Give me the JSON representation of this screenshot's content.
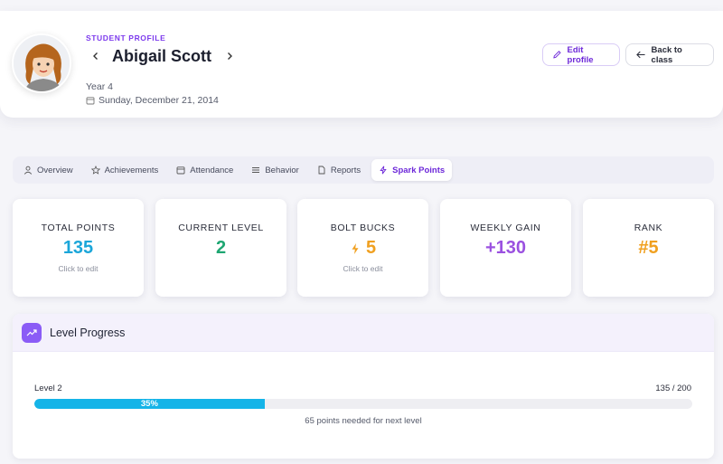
{
  "profile": {
    "eyebrow": "STUDENT PROFILE",
    "name": "Abigail Scott",
    "year": "Year 4",
    "birth_date": "Sunday, December 21, 2014",
    "edit_label": "Edit profile",
    "back_label": "Back to class"
  },
  "tabs": [
    {
      "label": "Overview",
      "icon": "user-icon"
    },
    {
      "label": "Achievements",
      "icon": "star-icon"
    },
    {
      "label": "Attendance",
      "icon": "calendar-icon"
    },
    {
      "label": "Behavior",
      "icon": "list-icon"
    },
    {
      "label": "Reports",
      "icon": "file-edit-icon"
    },
    {
      "label": "Spark Points",
      "icon": "bolt-icon",
      "active": true
    }
  ],
  "stats": [
    {
      "label": "TOTAL POINTS",
      "value": "135",
      "hint": "Click to edit",
      "color": "#1ba6d9"
    },
    {
      "label": "CURRENT LEVEL",
      "value": "2",
      "hint": "",
      "color": "#1ea672"
    },
    {
      "label": "BOLT BUCKS",
      "value": "5",
      "hint": "Click to edit",
      "color": "#f0a020",
      "icon": "bolt-icon"
    },
    {
      "label": "WEEKLY GAIN",
      "value": "+130",
      "hint": "",
      "color": "#9b51e0"
    },
    {
      "label": "RANK",
      "value": "#5",
      "hint": "",
      "color": "#f0a020"
    }
  ],
  "level_progress": {
    "title": "Level Progress",
    "level_label": "Level 2",
    "count": "135 / 200",
    "percent_label": "35%",
    "percent": 35,
    "needed": "65 points needed for next level"
  },
  "colors": {
    "accent": "#7c3aed",
    "progress": "#15b4e8"
  }
}
